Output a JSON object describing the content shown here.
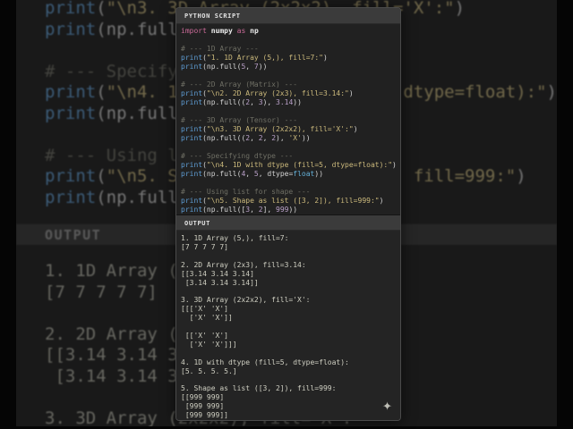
{
  "panel": {
    "script_header": "PYTHON SCRIPT",
    "output_header": "OUTPUT"
  },
  "colors": {
    "keyword": "#cc6b99",
    "function": "#5f9ed6",
    "string": "#cbb97c",
    "number": "#b9a0c8",
    "comment": "#6e6e64",
    "output_text": "#cfcfc2",
    "header_bg": "#3b3b3b",
    "script_bg": "#212121",
    "output_bg": "#242424"
  },
  "icons": {
    "sparkle_glyph": "✦"
  },
  "script_lines": [
    [
      [
        "kw",
        "import"
      ],
      [
        "tx",
        " "
      ],
      [
        "id",
        "numpy"
      ],
      [
        "tx",
        " "
      ],
      [
        "kw",
        "as"
      ],
      [
        "tx",
        " "
      ],
      [
        "id",
        "np"
      ]
    ],
    [],
    [
      [
        "com",
        "# --- 1D Array ---"
      ]
    ],
    [
      [
        "fn",
        "print"
      ],
      [
        "tx",
        "("
      ],
      [
        "str",
        "\"1. 1D Array (5,), fill=7:\""
      ],
      [
        "tx",
        ")"
      ]
    ],
    [
      [
        "fn",
        "print"
      ],
      [
        "tx",
        "(np.full("
      ],
      [
        "num",
        "5"
      ],
      [
        "tx",
        ", "
      ],
      [
        "num",
        "7"
      ],
      [
        "tx",
        "))"
      ]
    ],
    [],
    [
      [
        "com",
        "# --- 2D Array (Matrix) ---"
      ]
    ],
    [
      [
        "fn",
        "print"
      ],
      [
        "tx",
        "("
      ],
      [
        "str",
        "\"\\n2. 2D Array (2x3), fill=3.14:\""
      ],
      [
        "tx",
        ")"
      ]
    ],
    [
      [
        "fn",
        "print"
      ],
      [
        "tx",
        "(np.full(("
      ],
      [
        "num",
        "2"
      ],
      [
        "tx",
        ", "
      ],
      [
        "num",
        "3"
      ],
      [
        "tx",
        "), "
      ],
      [
        "num",
        "3.14"
      ],
      [
        "tx",
        "))"
      ]
    ],
    [],
    [
      [
        "com",
        "# --- 3D Array (Tensor) ---"
      ]
    ],
    [
      [
        "fn",
        "print"
      ],
      [
        "tx",
        "("
      ],
      [
        "str",
        "\"\\n3. 3D Array (2x2x2), fill='X':\""
      ],
      [
        "tx",
        ")"
      ]
    ],
    [
      [
        "fn",
        "print"
      ],
      [
        "tx",
        "(np.full(("
      ],
      [
        "num",
        "2"
      ],
      [
        "tx",
        ", "
      ],
      [
        "num",
        "2"
      ],
      [
        "tx",
        ", "
      ],
      [
        "num",
        "2"
      ],
      [
        "tx",
        "), "
      ],
      [
        "str",
        "'X'"
      ],
      [
        "tx",
        "))"
      ]
    ],
    [],
    [
      [
        "com",
        "# --- Specifying dtype ---"
      ]
    ],
    [
      [
        "fn",
        "print"
      ],
      [
        "tx",
        "("
      ],
      [
        "str",
        "\"\\n4. 1D with dtype (fill=5, dtype=float):\""
      ],
      [
        "tx",
        ")"
      ]
    ],
    [
      [
        "fn",
        "print"
      ],
      [
        "tx",
        "(np.full("
      ],
      [
        "num",
        "4"
      ],
      [
        "tx",
        ", "
      ],
      [
        "num",
        "5"
      ],
      [
        "tx",
        ", dtype="
      ],
      [
        "blt",
        "float"
      ],
      [
        "tx",
        "))"
      ]
    ],
    [],
    [
      [
        "com",
        "# --- Using list for shape ---"
      ]
    ],
    [
      [
        "fn",
        "print"
      ],
      [
        "tx",
        "("
      ],
      [
        "str",
        "\"\\n5. Shape as list ([3, 2]), fill=999:\""
      ],
      [
        "tx",
        ")"
      ]
    ],
    [
      [
        "fn",
        "print"
      ],
      [
        "tx",
        "(np.full(["
      ],
      [
        "num",
        "3"
      ],
      [
        "tx",
        ", "
      ],
      [
        "num",
        "2"
      ],
      [
        "tx",
        "], "
      ],
      [
        "num",
        "999"
      ],
      [
        "tx",
        "))"
      ]
    ]
  ],
  "output_lines": [
    "1. 1D Array (5,), fill=7:",
    "[7 7 7 7 7]",
    "",
    "2. 2D Array (2x3), fill=3.14:",
    "[[3.14 3.14 3.14]",
    " [3.14 3.14 3.14]]",
    "",
    "3. 3D Array (2x2x2), fill='X':",
    "[[['X' 'X']",
    "  ['X' 'X']]",
    "",
    " [['X' 'X']",
    "  ['X' 'X']]]",
    "",
    "4. 1D with dtype (fill=5, dtype=float):",
    "[5. 5. 5. 5.]",
    "",
    "5. Shape as list ([3, 2]), fill=999:",
    "[[999 999]",
    " [999 999]",
    " [999 999]]"
  ]
}
